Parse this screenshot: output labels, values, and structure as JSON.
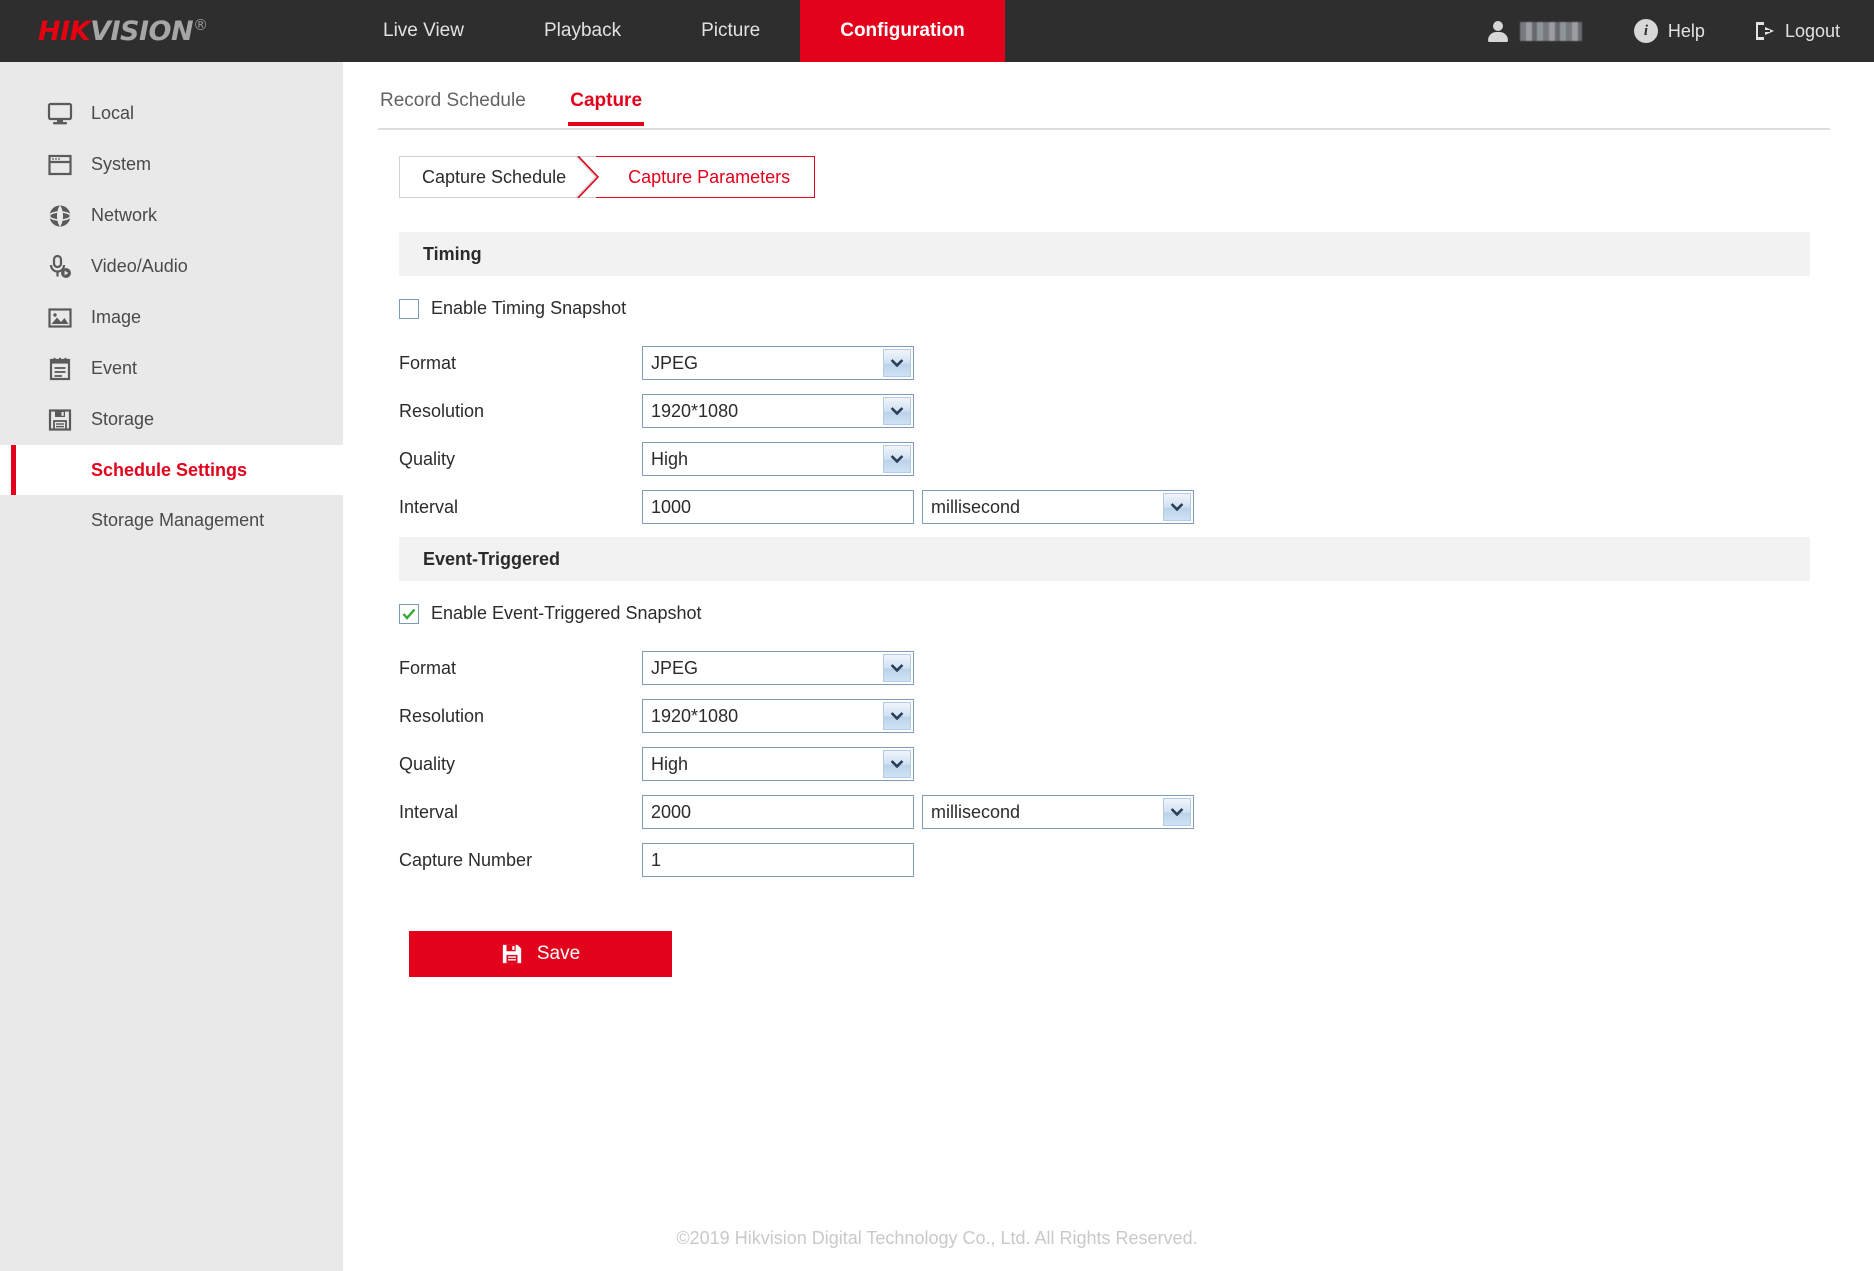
{
  "brand": {
    "logo_hik": "HIK",
    "logo_vision": "VISION",
    "logo_reg": "®"
  },
  "topnav": {
    "items": [
      {
        "label": "Live View",
        "active": false
      },
      {
        "label": "Playback",
        "active": false
      },
      {
        "label": "Picture",
        "active": false
      },
      {
        "label": "Configuration",
        "active": true
      }
    ],
    "user_icon": "user-icon",
    "user_name": "",
    "help_label": "Help",
    "help_icon": "info-icon",
    "logout_label": "Logout",
    "logout_icon": "logout-icon"
  },
  "sidebar": {
    "items": [
      {
        "label": "Local",
        "icon": "monitor-icon"
      },
      {
        "label": "System",
        "icon": "window-icon"
      },
      {
        "label": "Network",
        "icon": "globe-icon"
      },
      {
        "label": "Video/Audio",
        "icon": "mic-video-icon"
      },
      {
        "label": "Image",
        "icon": "picture-icon"
      },
      {
        "label": "Event",
        "icon": "notepad-icon"
      },
      {
        "label": "Storage",
        "icon": "floppy-icon"
      }
    ],
    "subitems": [
      {
        "label": "Schedule Settings",
        "active": true
      },
      {
        "label": "Storage Management",
        "active": false
      }
    ]
  },
  "tabs": [
    {
      "label": "Record Schedule",
      "active": false
    },
    {
      "label": "Capture",
      "active": true
    }
  ],
  "steps": [
    {
      "label": "Capture Schedule",
      "active": false
    },
    {
      "label": "Capture Parameters",
      "active": true
    }
  ],
  "timing": {
    "section_title": "Timing",
    "enable_label": "Enable Timing Snapshot",
    "enable_checked": false,
    "format_label": "Format",
    "format_value": "JPEG",
    "resolution_label": "Resolution",
    "resolution_value": "1920*1080",
    "quality_label": "Quality",
    "quality_value": "High",
    "interval_label": "Interval",
    "interval_value": "1000",
    "interval_unit": "millisecond"
  },
  "event_triggered": {
    "section_title": "Event-Triggered",
    "enable_label": "Enable Event-Triggered Snapshot",
    "enable_checked": true,
    "format_label": "Format",
    "format_value": "JPEG",
    "resolution_label": "Resolution",
    "resolution_value": "1920*1080",
    "quality_label": "Quality",
    "quality_value": "High",
    "interval_label": "Interval",
    "interval_value": "2000",
    "interval_unit": "millisecond",
    "capture_number_label": "Capture Number",
    "capture_number_value": "1"
  },
  "actions": {
    "save_label": "Save",
    "save_icon": "floppy-icon"
  },
  "footer": {
    "copyright": "©2019 Hikvision Digital Technology Co., Ltd. All Rights Reserved."
  },
  "colors": {
    "brand_red": "#e2021b",
    "topbar_bg": "#2e2e2e",
    "sidebar_bg": "#e9e9e9",
    "section_bg": "#f2f2f2",
    "field_border": "#7f9db9"
  }
}
